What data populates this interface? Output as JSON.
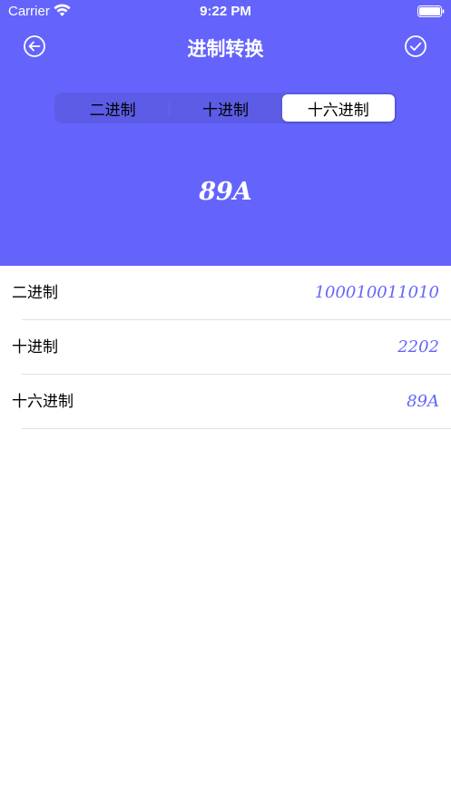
{
  "status_bar": {
    "carrier": "Carrier",
    "time": "9:22 PM"
  },
  "nav": {
    "title": "进制转换",
    "back_icon": "arrow-left-circle-icon",
    "confirm_icon": "check-circle-icon"
  },
  "segments": [
    {
      "label": "二进制",
      "selected": false
    },
    {
      "label": "十进制",
      "selected": false
    },
    {
      "label": "十六进制",
      "selected": true
    }
  ],
  "main_value": "89A",
  "results": [
    {
      "label": "二进制",
      "value": "100010011010"
    },
    {
      "label": "十进制",
      "value": "2202"
    },
    {
      "label": "十六进制",
      "value": "89A"
    }
  ],
  "colors": {
    "accent": "#6464fc",
    "segment_bg": "#5c5ce6",
    "divider": "#e0e0e0"
  }
}
